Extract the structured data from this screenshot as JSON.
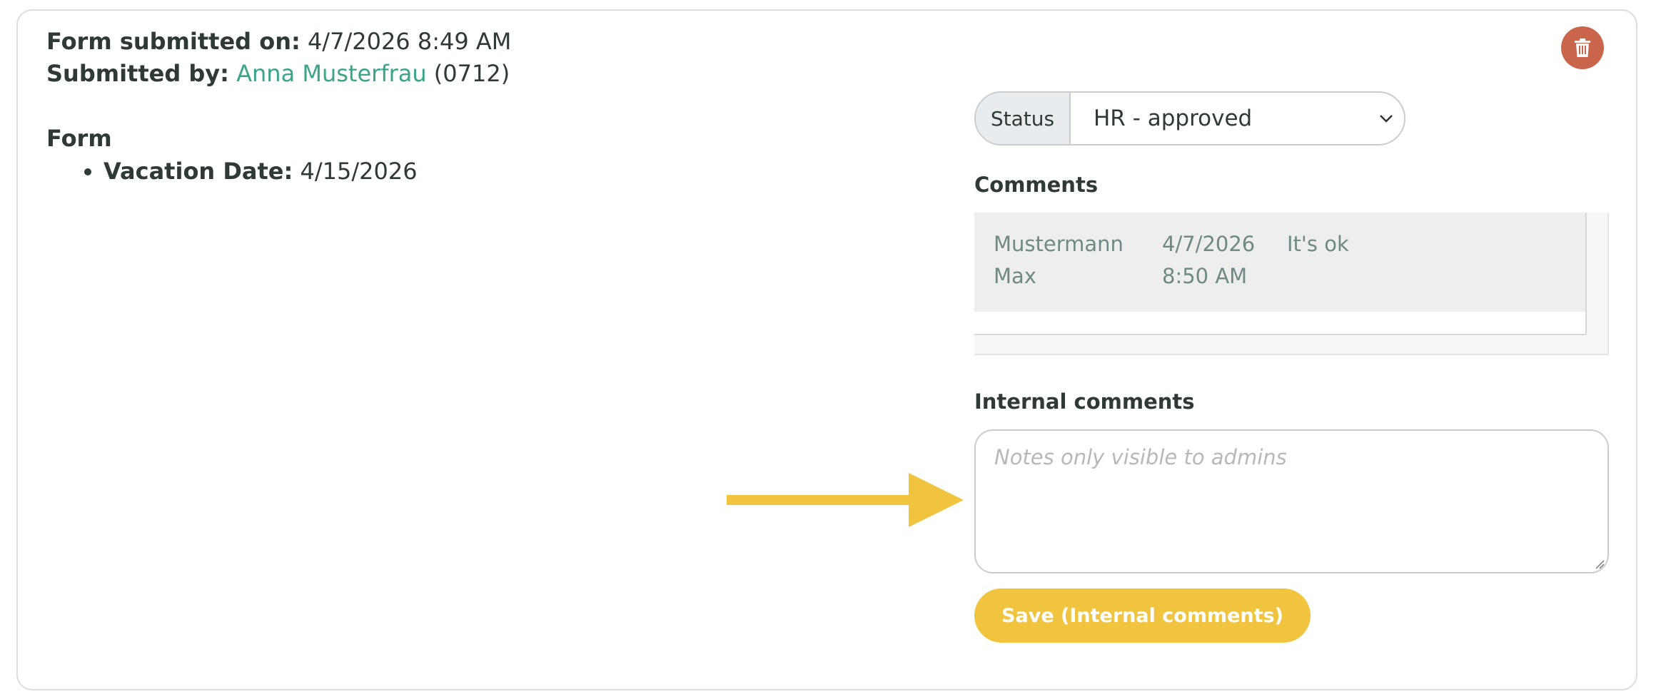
{
  "submission": {
    "submitted_on_label": "Form submitted on:",
    "submitted_on_value": "4/7/2026 8:49 AM",
    "submitted_by_label": "Submitted by:",
    "submitted_by_name": "Anna Musterfrau",
    "submitted_by_id": "(0712)"
  },
  "form": {
    "title": "Form",
    "fields": [
      {
        "label": "Vacation Date:",
        "value": "4/15/2026"
      }
    ]
  },
  "status": {
    "label": "Status",
    "selected": "HR - approved"
  },
  "comments": {
    "title": "Comments",
    "rows": [
      {
        "author": "Mustermann Max",
        "date": "4/7/2026 8:50 AM",
        "text": "It's ok"
      }
    ]
  },
  "internal_comments": {
    "title": "Internal comments",
    "placeholder": "Notes only visible to admins",
    "value": "",
    "save_label": "Save (Internal comments)"
  },
  "icons": {
    "delete": "trash-icon",
    "select_arrow": "chevron-down-icon",
    "annotation": "arrow-right-icon"
  },
  "colors": {
    "link": "#3aa588",
    "delete_button": "#c8654a",
    "save_button": "#f0c43f",
    "annotation_arrow": "#f0c43f"
  }
}
